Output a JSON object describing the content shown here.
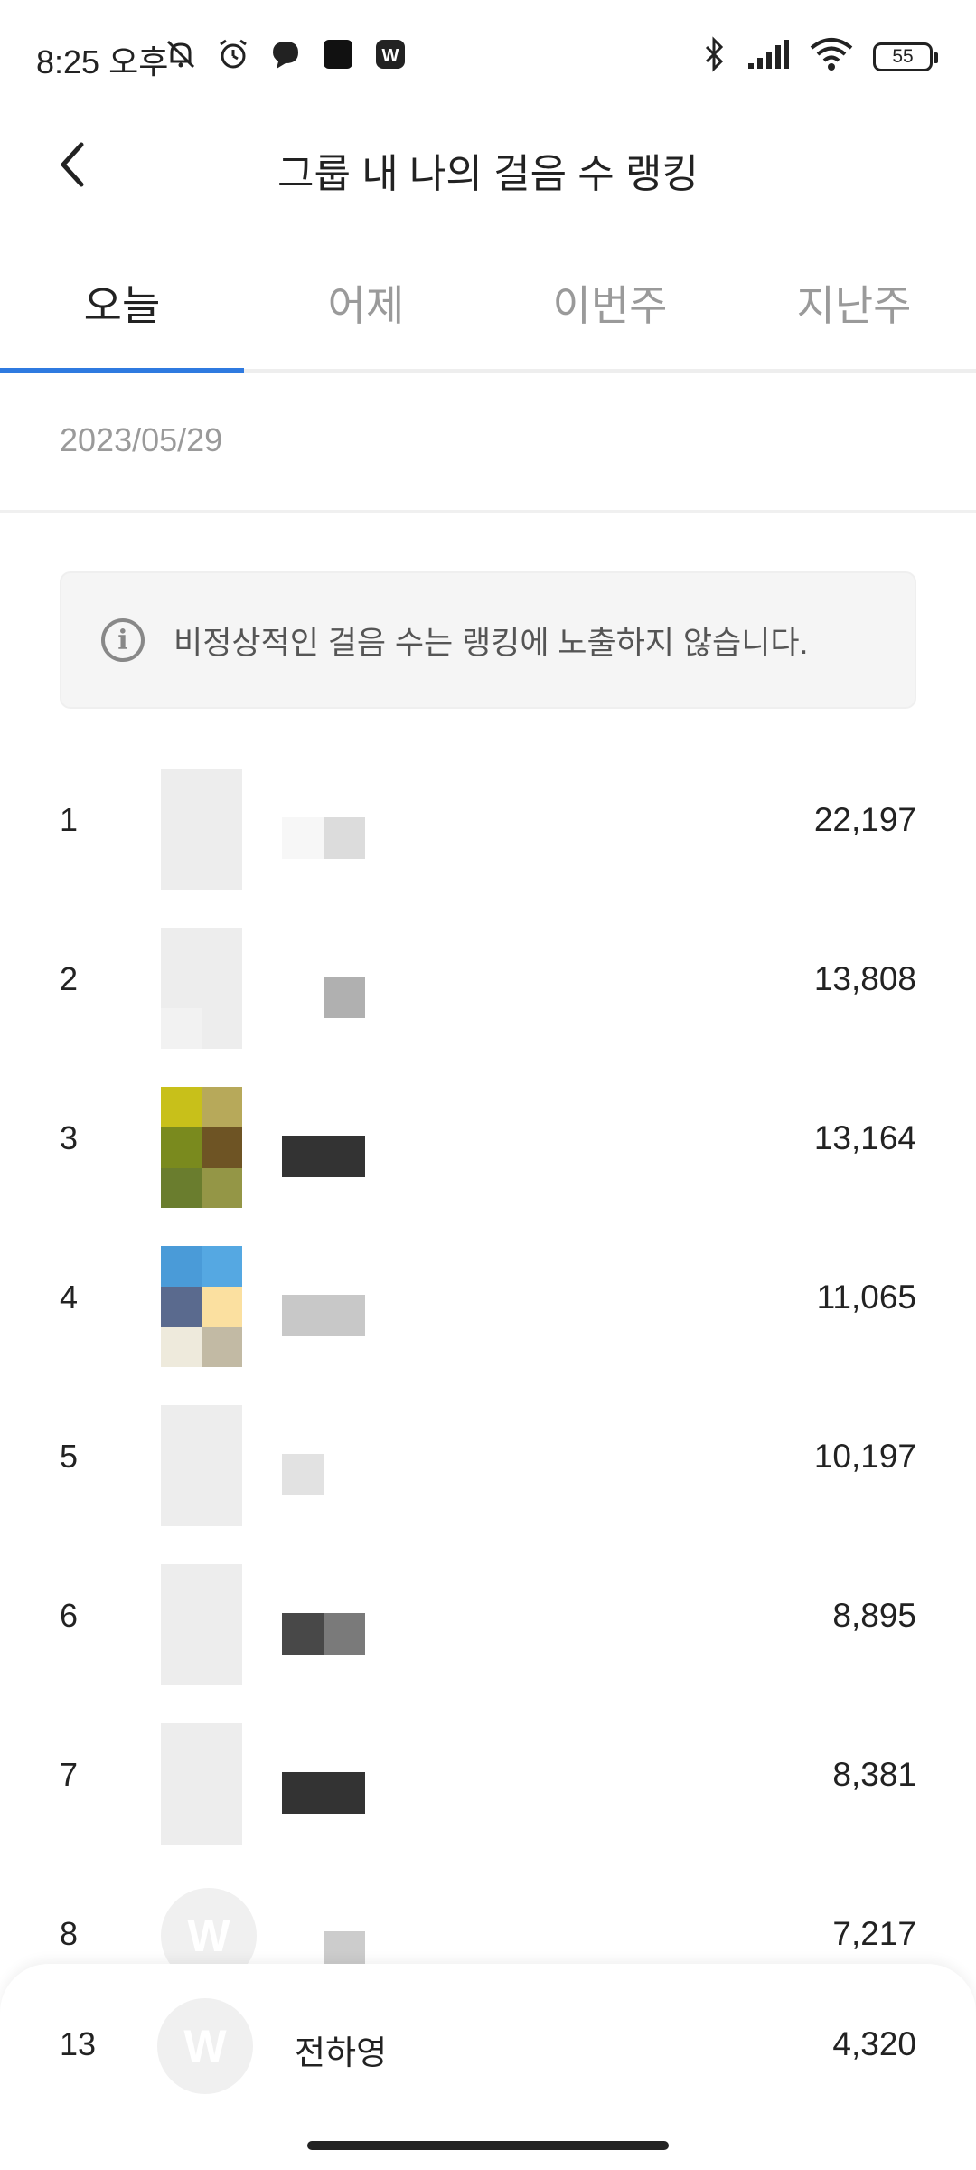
{
  "status_bar": {
    "time": "8:25 오후",
    "battery": "55",
    "left_icons": [
      "notifications-off-icon",
      "alarm-icon",
      "chat-bubble-icon",
      "app-square-icon",
      "w-app-icon"
    ],
    "right_icons": [
      "bluetooth-icon",
      "signal-icon",
      "wifi-icon",
      "battery-icon"
    ]
  },
  "header": {
    "title": "그룹 내 나의 걸음 수 랭킹",
    "back_icon": "chevron-left-icon"
  },
  "tabs": [
    {
      "label": "오늘",
      "active": true
    },
    {
      "label": "어제",
      "active": false
    },
    {
      "label": "이번주",
      "active": false
    },
    {
      "label": "지난주",
      "active": false
    }
  ],
  "date": "2023/05/29",
  "notice": {
    "icon": "info-icon",
    "text": "비정상적인 걸음 수는 랭킹에 노출하지 않습니다."
  },
  "ranking": [
    {
      "rank": "1",
      "steps": "22,197"
    },
    {
      "rank": "2",
      "steps": "13,808"
    },
    {
      "rank": "3",
      "steps": "13,164"
    },
    {
      "rank": "4",
      "steps": "11,065"
    },
    {
      "rank": "5",
      "steps": "10,197"
    },
    {
      "rank": "6",
      "steps": "8,895"
    },
    {
      "rank": "7",
      "steps": "8,381"
    },
    {
      "rank": "8",
      "steps": "7,217"
    }
  ],
  "my_rank": {
    "rank": "13",
    "name": "전하영",
    "steps": "4,320",
    "avatar_letter": "W"
  },
  "colors": {
    "accent": "#2f7ae0",
    "muted_text": "#9a9a9a",
    "notice_bg": "#f5f5f5"
  }
}
